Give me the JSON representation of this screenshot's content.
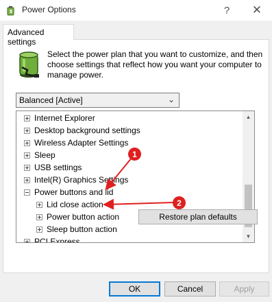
{
  "window": {
    "title": "Power Options",
    "help_glyph": "?",
    "close_glyph": "✕"
  },
  "tab": {
    "label": "Advanced settings"
  },
  "description": "Select the power plan that you want to customize, and then choose settings that reflect how you want your computer to manage power.",
  "plan_select": {
    "value": "Balanced [Active]"
  },
  "tree": {
    "items": [
      {
        "label": "Internet Explorer",
        "level": 0,
        "expanded": false
      },
      {
        "label": "Desktop background settings",
        "level": 0,
        "expanded": false
      },
      {
        "label": "Wireless Adapter Settings",
        "level": 0,
        "expanded": false
      },
      {
        "label": "Sleep",
        "level": 0,
        "expanded": false
      },
      {
        "label": "USB settings",
        "level": 0,
        "expanded": false
      },
      {
        "label": "Intel(R) Graphics Settings",
        "level": 0,
        "expanded": false
      },
      {
        "label": "Power buttons and lid",
        "level": 0,
        "expanded": true
      },
      {
        "label": "Lid close action",
        "level": 1,
        "expanded": false
      },
      {
        "label": "Power button action",
        "level": 1,
        "expanded": false
      },
      {
        "label": "Sleep button action",
        "level": 1,
        "expanded": false
      },
      {
        "label": "PCI Express",
        "level": 0,
        "expanded": false
      }
    ]
  },
  "buttons": {
    "restore": "Restore plan defaults",
    "ok": "OK",
    "cancel": "Cancel",
    "apply": "Apply"
  },
  "annotations": {
    "badge1": "1",
    "badge2": "2",
    "color": "#e02020"
  }
}
